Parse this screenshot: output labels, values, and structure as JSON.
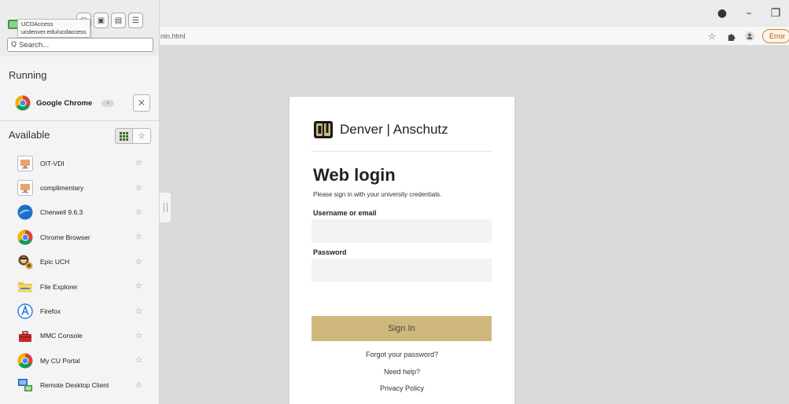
{
  "browser": {
    "url_fragment": "nin.html",
    "error_label": "Error",
    "window_controls": {
      "profile": "●",
      "minimize": "–",
      "restore": "❐"
    }
  },
  "sidebar": {
    "tooltip": {
      "line1": "UCDAccess",
      "line2": "ucdenver.edu/ucdaccess"
    },
    "search_placeholder": "Search...",
    "running_title": "Running",
    "running_apps": [
      {
        "name": "Google Chrome",
        "icon": "chrome-icon"
      }
    ],
    "available_title": "Available",
    "apps": [
      {
        "name": "OIT-VDI",
        "icon": "desktop-icon"
      },
      {
        "name": "complimentary",
        "icon": "desktop-icon"
      },
      {
        "name": "Cherwell 9.6.3",
        "icon": "cherwell-icon"
      },
      {
        "name": "Chrome Browser",
        "icon": "chrome-icon"
      },
      {
        "name": "Epic UCH",
        "icon": "epic-icon"
      },
      {
        "name": "File Explorer",
        "icon": "folder-icon"
      },
      {
        "name": "Firefox",
        "icon": "firefox-icon"
      },
      {
        "name": "MMC Console",
        "icon": "toolbox-icon"
      },
      {
        "name": "My CU Portal",
        "icon": "chrome-icon"
      },
      {
        "name": "Remote Desktop Client",
        "icon": "remote-desktop-icon"
      }
    ]
  },
  "login": {
    "brand": "Denver | Anschutz",
    "title": "Web login",
    "subtitle": "Please sign in with your university credentials.",
    "username_label": "Username or email",
    "password_label": "Password",
    "signin_label": "Sign In",
    "forgot_label": "Forgot your password?",
    "help_label": "Need help?",
    "privacy_label": "Privacy Policy"
  },
  "colors": {
    "accent_gold": "#cfb87c",
    "error_orange": "#d6802a"
  }
}
